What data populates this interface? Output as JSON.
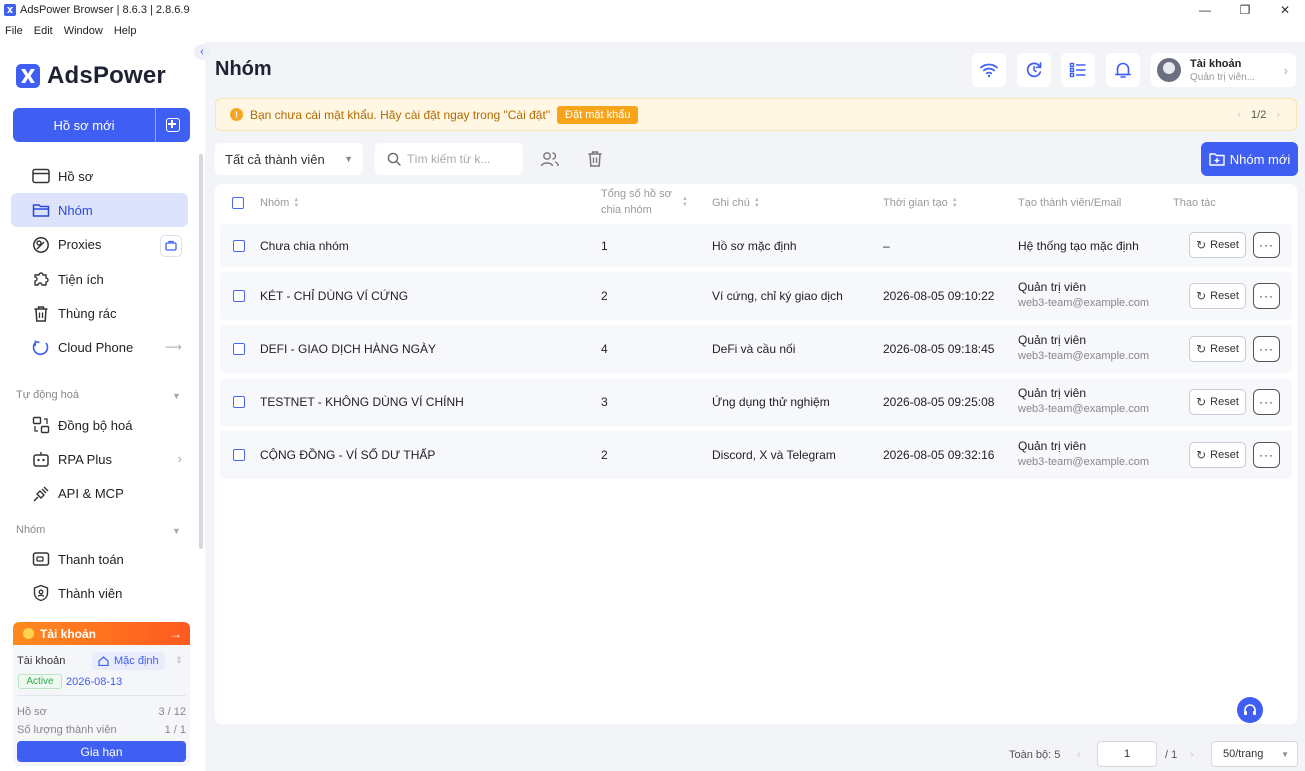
{
  "window": {
    "title": "AdsPower Browser | 8.6.3 | 2.8.6.9",
    "minimize": "—",
    "maximize": "❐",
    "close": "✕"
  },
  "menu": [
    "File",
    "Edit",
    "Window",
    "Help"
  ],
  "sidebar": {
    "logo": "AdsPower",
    "new_profile": "Hồ sơ mới",
    "items": [
      {
        "label": "Hồ sơ",
        "icon": "profile-window-icon"
      },
      {
        "label": "Nhóm",
        "icon": "folder-icon",
        "active": true
      },
      {
        "label": "Proxies",
        "icon": "proxy-icon"
      },
      {
        "label": "Tiện ích",
        "icon": "puzzle-icon"
      },
      {
        "label": "Thùng rác",
        "icon": "trash-icon"
      },
      {
        "label": "Cloud Phone",
        "icon": "cloud-phone-icon"
      }
    ],
    "section_automation": "Tự động hoá",
    "automation_items": [
      {
        "label": "Đồng bộ hoá",
        "icon": "sync-icon"
      },
      {
        "label": "RPA Plus",
        "icon": "robot-icon"
      },
      {
        "label": "API & MCP",
        "icon": "plug-icon"
      }
    ],
    "section_team": "Nhóm",
    "team_items": [
      {
        "label": "Thanh toán",
        "icon": "wallet-icon"
      },
      {
        "label": "Thành viên",
        "icon": "shield-user-icon"
      }
    ],
    "account_card": {
      "header": "Tài khoản",
      "label": "Tài khoản",
      "plan": "Mặc định",
      "status": "Active",
      "expiry": "2026-08-13",
      "profiles_label": "Hồ sơ",
      "profiles_value": "3 / 12",
      "members_label": "Số lượng thành viên",
      "members_value": "1 / 1",
      "renew": "Gia hạn"
    }
  },
  "header": {
    "title": "Nhóm",
    "account_name": "Tài khoản",
    "account_role": "Quản trị viên..."
  },
  "warning": {
    "text": "Bạn chưa cài mật khẩu. Hãy cài đặt ngay trong \"Cài đặt\"",
    "button": "Đặt mật khẩu",
    "pager": "1/2"
  },
  "toolbar": {
    "filter": "Tất cả thành viên",
    "search_placeholder": "Tìm kiếm từ k...",
    "new_group": "Nhóm mới"
  },
  "table": {
    "headers": {
      "name": "Nhóm",
      "count_line1": "Tổng số hồ sơ",
      "count_line2": "chia nhóm",
      "note": "Ghi chú",
      "created": "Thời gian tạo",
      "creator": "Tạo thành viên/Email",
      "actions": "Thao tác"
    },
    "rows": [
      {
        "name": "Chưa chia nhóm",
        "count": "1",
        "note": "Hồ sơ mặc định",
        "created": "–",
        "creator": "Hệ thống tạo mặc định",
        "email": ""
      },
      {
        "name": "KÉT - CHỈ DÙNG VÍ CỨNG",
        "count": "2",
        "note": "Ví cứng, chỉ ký giao dịch",
        "created": "2026-08-05 09:10:22",
        "creator": "Quản trị viên",
        "email": "web3-team@example.com"
      },
      {
        "name": "DEFI - GIAO DỊCH HÀNG NGÀY",
        "count": "4",
        "note": "DeFi và cầu nối",
        "created": "2026-08-05 09:18:45",
        "creator": "Quản trị viên",
        "email": "web3-team@example.com"
      },
      {
        "name": "TESTNET - KHÔNG DÙNG VÍ CHÍNH",
        "count": "3",
        "note": "Ứng dụng thử nghiệm",
        "created": "2026-08-05 09:25:08",
        "creator": "Quản trị viên",
        "email": "web3-team@example.com"
      },
      {
        "name": "CỘNG ĐỒNG - VÍ SỐ DƯ THẤP",
        "count": "2",
        "note": "Discord, X và Telegram",
        "created": "2026-08-05 09:32:16",
        "creator": "Quản trị viên",
        "email": "web3-team@example.com"
      }
    ],
    "reset_label": "Reset",
    "more_label": "···"
  },
  "footer": {
    "total": "Toàn bộ: 5",
    "page": "1",
    "of": "/ 1",
    "per_page": "50/trang"
  },
  "colors": {
    "accent": "#3f5ef2",
    "warning": "#f6a51b",
    "orange": "#ff6a1f"
  }
}
